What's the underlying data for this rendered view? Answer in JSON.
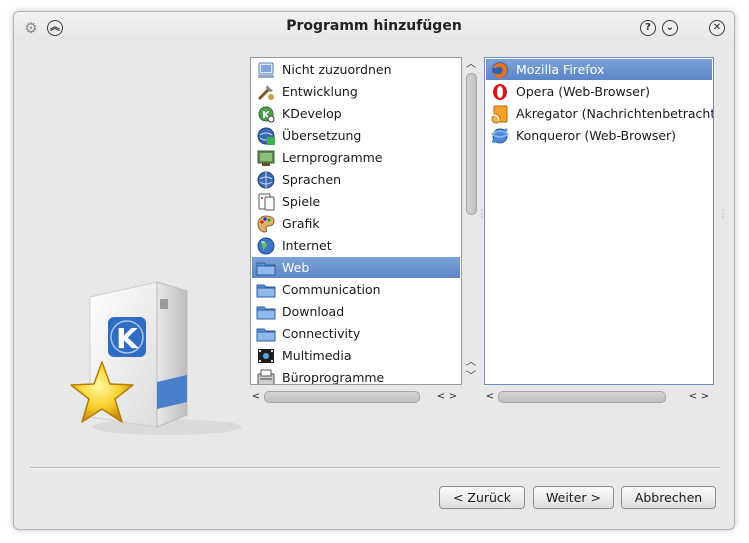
{
  "window": {
    "title": "Programm hinzufügen"
  },
  "categories": [
    {
      "label": "Nicht zuzuordnen",
      "icon": "unknown-app-icon",
      "selected": false
    },
    {
      "label": "Entwicklung",
      "icon": "development-tools-icon",
      "selected": false
    },
    {
      "label": "KDevelop",
      "icon": "kdevelop-icon",
      "selected": false
    },
    {
      "label": "Übersetzung",
      "icon": "translation-icon",
      "selected": false
    },
    {
      "label": "Lernprogramme",
      "icon": "education-icon",
      "selected": false
    },
    {
      "label": "Sprachen",
      "icon": "languages-icon",
      "selected": false
    },
    {
      "label": "Spiele",
      "icon": "games-icon",
      "selected": false
    },
    {
      "label": "Grafik",
      "icon": "graphics-palette-icon",
      "selected": false
    },
    {
      "label": "Internet",
      "icon": "internet-globe-icon",
      "selected": false
    },
    {
      "label": "Web",
      "icon": "folder-icon",
      "selected": true
    },
    {
      "label": "Communication",
      "icon": "folder-icon",
      "selected": false
    },
    {
      "label": "Download",
      "icon": "folder-icon",
      "selected": false
    },
    {
      "label": "Connectivity",
      "icon": "folder-icon",
      "selected": false
    },
    {
      "label": "Multimedia",
      "icon": "multimedia-icon",
      "selected": false
    },
    {
      "label": "Büroprogramme",
      "icon": "office-icon",
      "selected": false
    }
  ],
  "programs": [
    {
      "label": "Mozilla Firefox",
      "icon": "firefox-icon",
      "selected": true
    },
    {
      "label": "Opera (Web-Browser)",
      "icon": "opera-icon",
      "selected": false
    },
    {
      "label": "Akregator (Nachrichtenbetrachter)",
      "icon": "akregator-icon",
      "selected": false
    },
    {
      "label": "Konqueror (Web-Browser)",
      "icon": "konqueror-icon",
      "selected": false
    }
  ],
  "buttons": {
    "back": "< Zurück",
    "next": "Weiter >",
    "cancel": "Abbrechen"
  },
  "colors": {
    "selection": "#6a93cf",
    "window_bg": "#e8e8e8"
  }
}
